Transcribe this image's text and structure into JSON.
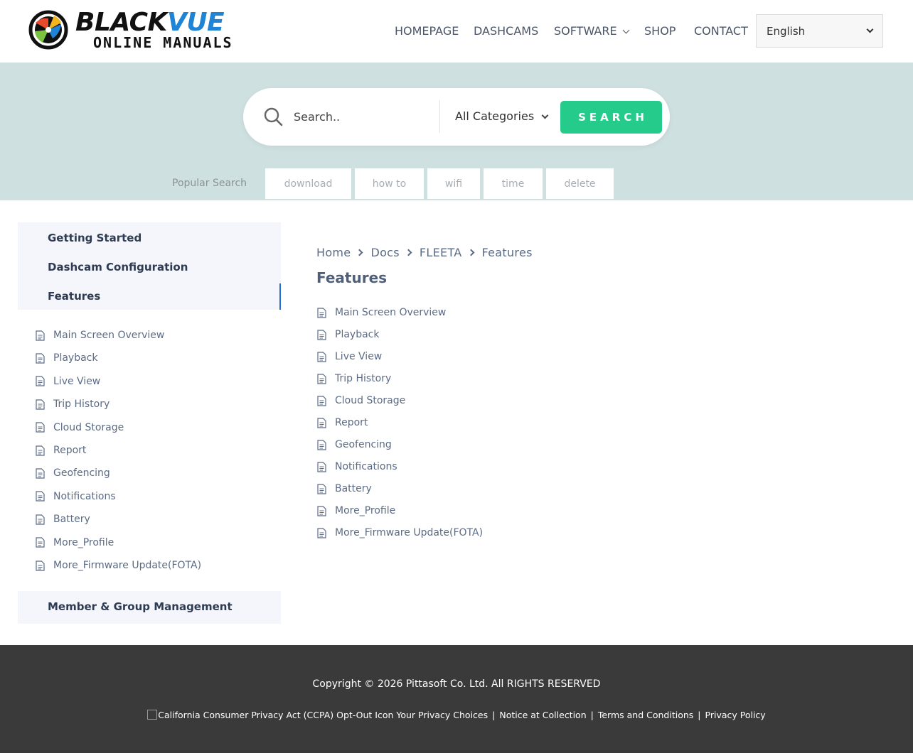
{
  "header": {
    "logo": {
      "word1_black": "BLACK",
      "word1_blue": "VUE",
      "word2": "ONLINE MANUALS"
    },
    "nav": [
      {
        "label": "HOMEPAGE"
      },
      {
        "label": "DASHCAMS"
      },
      {
        "label": "SOFTWARE",
        "has_dropdown": true
      },
      {
        "label": "SHOP"
      },
      {
        "label": "CONTACT"
      }
    ],
    "language": {
      "selected": "English"
    }
  },
  "search": {
    "placeholder": "Search..",
    "category_selected": "All Categories",
    "button_label": "SEARCH",
    "popular_label": "Popular Search",
    "popular_tags": [
      "download",
      "how to",
      "wifi",
      "time",
      "delete"
    ]
  },
  "sidebar": {
    "sections": [
      {
        "label": "Getting Started"
      },
      {
        "label": "Dashcam Configuration"
      },
      {
        "label": "Features",
        "active": true
      },
      {
        "label": "Member & Group Management"
      }
    ],
    "items": [
      "Main Screen Overview",
      "Playback",
      "Live View",
      "Trip History",
      "Cloud Storage",
      "Report",
      "Geofencing",
      "Notifications",
      "Battery",
      "More_Profile",
      "More_Firmware Update(FOTA)"
    ]
  },
  "main": {
    "breadcrumb": [
      "Home",
      "Docs",
      "FLEETA",
      "Features"
    ],
    "title": "Features",
    "items": [
      "Main Screen Overview",
      "Playback",
      "Live View",
      "Trip History",
      "Cloud Storage",
      "Report",
      "Geofencing",
      "Notifications",
      "Battery",
      "More_Profile",
      "More_Firmware Update(FOTA)"
    ]
  },
  "footer": {
    "copyright": "Copyright © 2026 Pittasoft Co. Ltd. All RIGHTS RESERVED",
    "ccpa_alt": "California Consumer Privacy Act (CCPA) Opt-Out Icon",
    "links": [
      "Your Privacy Choices",
      "Notice at Collection",
      "Terms and Conditions",
      "Privacy Policy"
    ]
  },
  "colors": {
    "accent": "#25cb8b",
    "hero_bg": "#cfe0e1",
    "sidebar_bg": "#f4f6fb",
    "active_bar": "#1f6fcf",
    "footer_bg": "#3a3a3a",
    "brand_blue": "#1f84d6"
  },
  "icons": {
    "search": "search-icon",
    "document": "document-icon",
    "chevron": "chevron-down-icon",
    "breadcrumb_separator": "chevron-right-icon"
  }
}
